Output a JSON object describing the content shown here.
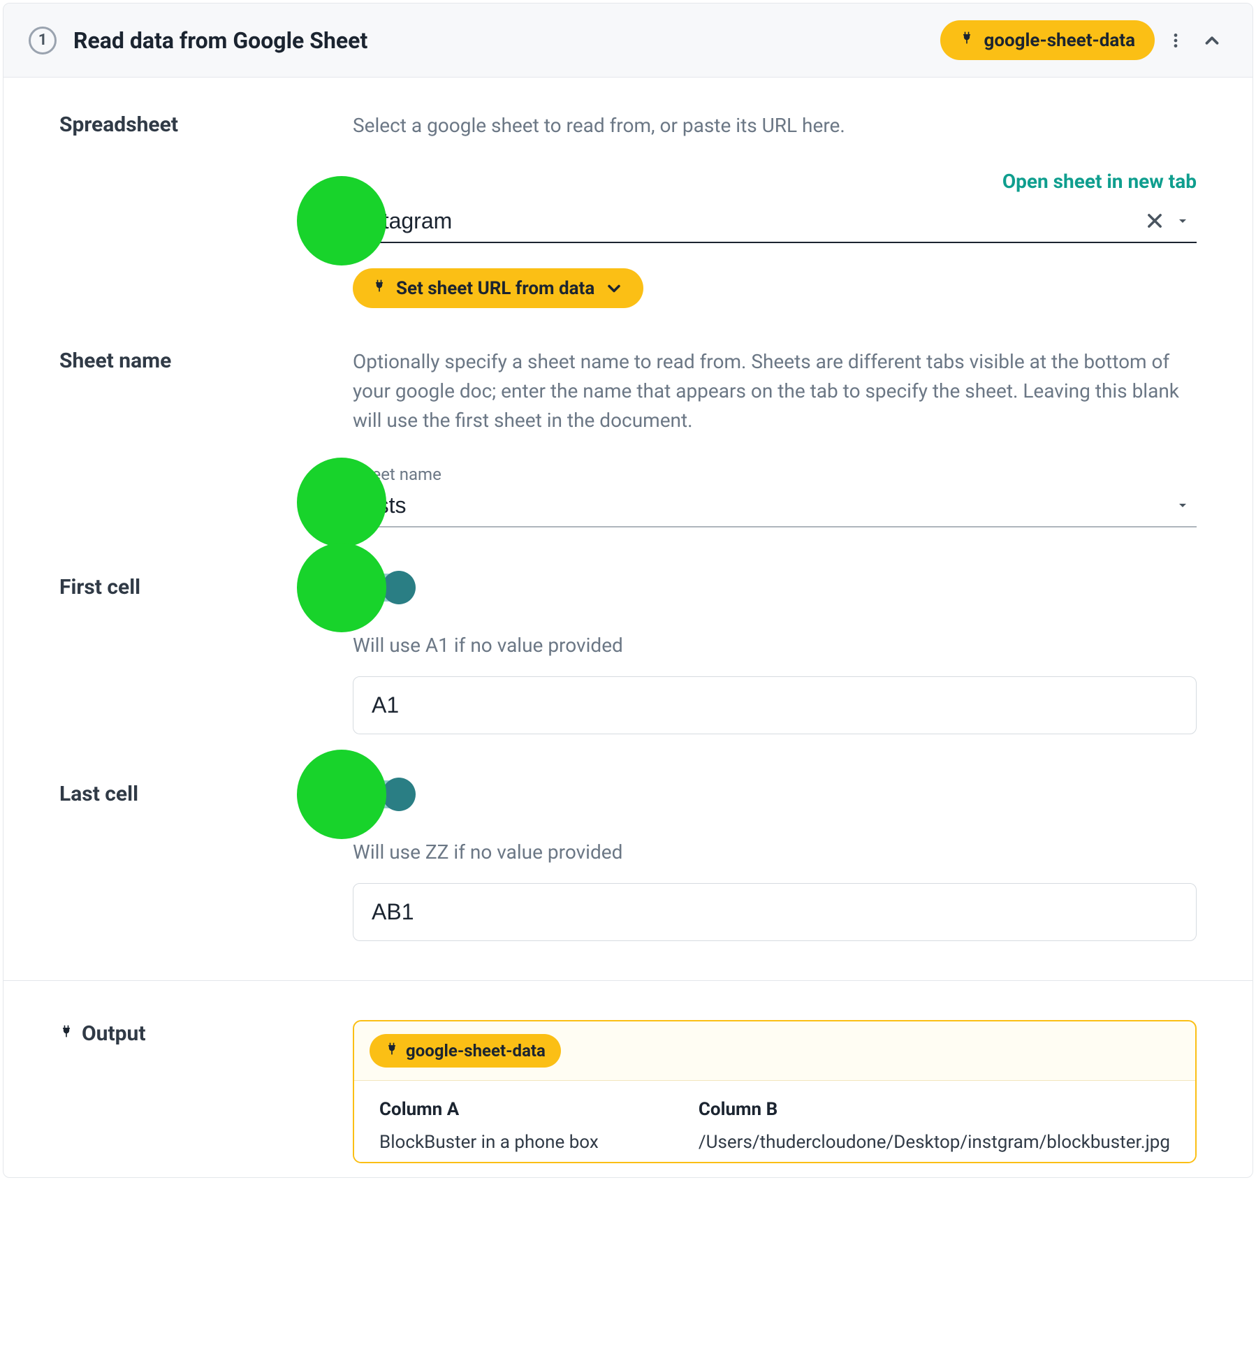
{
  "header": {
    "step": "1",
    "title": "Read data from Google Sheet",
    "data_badge": "google-sheet-data"
  },
  "spreadsheet": {
    "label": "Spreadsheet",
    "desc": "Select a google sheet to read from, or paste its URL here.",
    "open_link": "Open sheet in new tab",
    "value": "Instagram",
    "set_url_btn": "Set sheet URL from data"
  },
  "sheet_name": {
    "label": "Sheet name",
    "desc": "Optionally specify a sheet name to read from. Sheets are different tabs visible at the bottom of your google doc; enter the name that appears on the tab to specify the sheet. Leaving this blank will use the first sheet in the document.",
    "field_label": "Sheet name",
    "value": "posts"
  },
  "first_cell": {
    "label": "First cell",
    "hint": "Will use A1 if no value provided",
    "value": "A1"
  },
  "last_cell": {
    "label": "Last cell",
    "hint": "Will use ZZ if no value provided",
    "value": "AB1"
  },
  "output": {
    "label": "Output",
    "badge": "google-sheet-data",
    "columns": [
      {
        "head": "Column A",
        "value": "BlockBuster in a phone box"
      },
      {
        "head": "Column B",
        "value": "/Users/thudercloudone/Desktop/instgram/blockbuster.jpg"
      }
    ]
  }
}
